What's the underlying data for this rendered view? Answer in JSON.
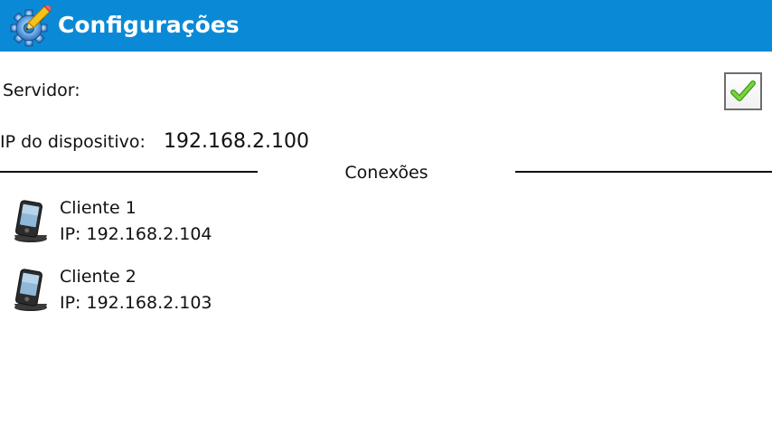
{
  "header": {
    "title": "Configurações",
    "icon": "settings-gear-pencil-icon",
    "background_color": "#0a8ad6"
  },
  "server": {
    "label": "Servidor:",
    "checked": true,
    "check_color": "#5dbb2e"
  },
  "device": {
    "ip_label": "IP do dispositivo:",
    "ip_value": "192.168.2.100"
  },
  "connections": {
    "title": "Conexões",
    "clients": [
      {
        "name": "Cliente 1",
        "ip": "IP: 192.168.2.104",
        "icon": "pda-device-icon"
      },
      {
        "name": "Cliente 2",
        "ip": "IP: 192.168.2.103",
        "icon": "pda-device-icon"
      }
    ]
  }
}
